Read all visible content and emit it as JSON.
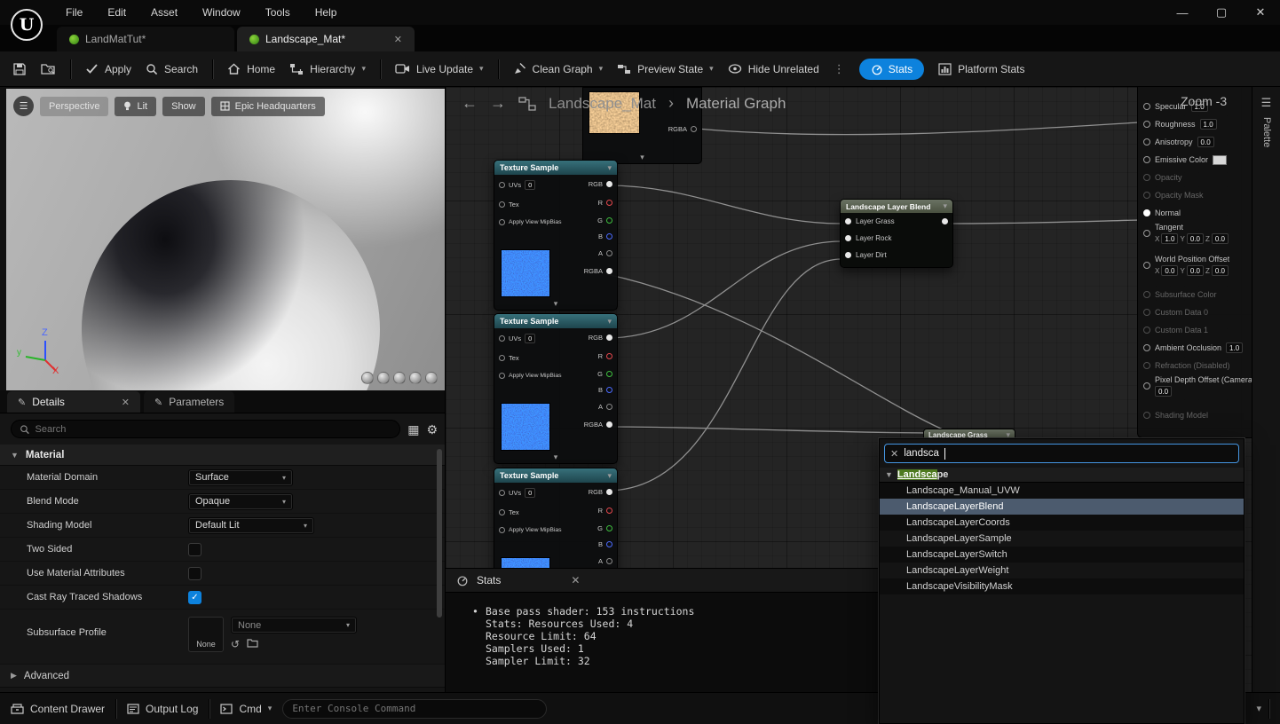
{
  "titlebar": {
    "logo": "U",
    "menus": [
      "File",
      "Edit",
      "Asset",
      "Window",
      "Tools",
      "Help"
    ]
  },
  "tabs": {
    "tab1": "LandMatTut*",
    "tab2": "Landscape_Mat*"
  },
  "toolbar": {
    "apply": "Apply",
    "search": "Search",
    "home": "Home",
    "hierarchy": "Hierarchy",
    "live_update": "Live Update",
    "clean_graph": "Clean Graph",
    "preview_state": "Preview State",
    "hide_unrelated": "Hide Unrelated",
    "stats": "Stats",
    "platform_stats": "Platform Stats"
  },
  "viewport": {
    "perspective": "Perspective",
    "lit": "Lit",
    "show": "Show",
    "location": "Epic Headquarters",
    "axis_x": "X",
    "axis_y": "y",
    "axis_z": "Z"
  },
  "details_panel": {
    "tab_details": "Details",
    "tab_parameters": "Parameters",
    "search_placeholder": "Search",
    "section": "Material",
    "rows": [
      {
        "label": "Material Domain",
        "value": "Surface"
      },
      {
        "label": "Blend Mode",
        "value": "Opaque"
      },
      {
        "label": "Shading Model",
        "value": "Default Lit"
      },
      {
        "label": "Two Sided"
      },
      {
        "label": "Use Material Attributes"
      },
      {
        "label": "Cast Ray Traced Shadows"
      }
    ],
    "subsurface": {
      "label": "Subsurface Profile",
      "thumb": "None",
      "value": "None"
    },
    "advanced": "Advanced"
  },
  "graph": {
    "breadcrumb_root": "Landscape_Mat",
    "breadcrumb_sep": "›",
    "breadcrumb_current": "Material Graph",
    "zoom_label": "Zoom -3",
    "texture_node": {
      "title": "Texture Sample",
      "uvs_label": "UVs",
      "uvs_value": "0",
      "tex_label": "Tex",
      "mip_label": "Apply View MipBias",
      "out_rgb": "RGB",
      "out_r": "R",
      "out_g": "G",
      "out_b": "B",
      "out_a": "A",
      "out_rgba": "RGBA"
    },
    "blend_node": {
      "title": "Landscape Layer Blend",
      "pins": [
        "Layer Grass",
        "Layer Rock",
        "Layer Dirt"
      ]
    },
    "grass_node": {
      "title": "Landscape Grass"
    },
    "main_node": {
      "specular": {
        "label": "Specular",
        "value": "1.0"
      },
      "roughness": {
        "label": "Roughness",
        "value": "1.0"
      },
      "anisotropy": {
        "label": "Anisotropy",
        "value": "0.0"
      },
      "emissive": {
        "label": "Emissive Color"
      },
      "opacity": {
        "label": "Opacity"
      },
      "opacity_mask": {
        "label": "Opacity Mask"
      },
      "normal": {
        "label": "Normal"
      },
      "tangent": {
        "label": "Tangent",
        "x": "1.0",
        "y": "0.0",
        "z": "0.0"
      },
      "wpo": {
        "label": "World Position Offset",
        "x": "0.0",
        "y": "0.0",
        "z": "0.0"
      },
      "subsurface_color": {
        "label": "Subsurface Color"
      },
      "custom0": {
        "label": "Custom Data 0"
      },
      "custom1": {
        "label": "Custom Data 1"
      },
      "ao": {
        "label": "Ambient Occlusion",
        "value": "1.0"
      },
      "refraction": {
        "label": "Refraction (Disabled)"
      },
      "pixel_depth": {
        "label": "Pixel Depth Offset (Camera V",
        "value": "0.0"
      },
      "shading_model": {
        "label": "Shading Model"
      },
      "axis_x": "X",
      "axis_y": "Y",
      "axis_z": "Z"
    },
    "palette_label": "Palette"
  },
  "stats_panel": {
    "title": "Stats",
    "lines": [
      "Base pass shader: 153 instructions",
      "Stats: Resources Used: 4",
      "Resource Limit: 64",
      "Samplers Used: 1",
      "Sampler Limit: 32"
    ]
  },
  "context_menu": {
    "query": "landsca",
    "category_match": "Landsca",
    "category_rest": "pe",
    "items": [
      "Landscape_Manual_UVW",
      "LandscapeLayerBlend",
      "LandscapeLayerCoords",
      "LandscapeLayerSample",
      "LandscapeLayerSwitch",
      "LandscapeLayerWeight",
      "LandscapeVisibilityMask"
    ]
  },
  "bottom_bar": {
    "content_drawer": "Content Drawer",
    "output_log": "Output Log",
    "cmd": "Cmd",
    "console_placeholder": "Enter Console Command"
  },
  "colors": {
    "accent_blue": "#0d82dd",
    "selection_row": "#4c5b6e",
    "texture_node_header": "#2e5f66",
    "blend_node_header": "#5a6352",
    "pin_red": "#e5484d",
    "pin_green": "#3fbf3f",
    "pin_blue": "#4a6aff"
  }
}
